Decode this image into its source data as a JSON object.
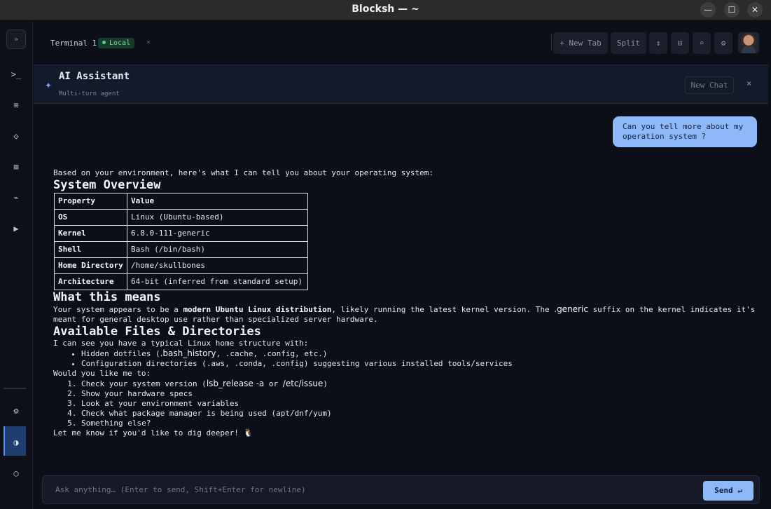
{
  "window": {
    "title": "Blocksh — ~",
    "minimize_glyph": "—",
    "maximize_glyph": "☐",
    "close_glyph": "✕"
  },
  "rail": {
    "toggle_glyph": "»",
    "items": [
      {
        "name": "terminal-icon",
        "glyph": ">_"
      },
      {
        "name": "menu-icon",
        "glyph": "≡"
      },
      {
        "name": "diamond-icon",
        "glyph": "◇"
      },
      {
        "name": "grid-icon",
        "glyph": "⊞"
      },
      {
        "name": "connection-icon",
        "glyph": "⌁"
      },
      {
        "name": "play-icon",
        "glyph": "▶"
      }
    ],
    "bottom": [
      {
        "name": "settings-icon",
        "glyph": "⚙"
      },
      {
        "name": "theme-icon",
        "glyph": "◑"
      },
      {
        "name": "circle-icon",
        "glyph": "○"
      }
    ]
  },
  "tabbar": {
    "tab_label": "Terminal 1",
    "tab_badge": "Local",
    "tab_close": "×",
    "new_tab": "+ New Tab",
    "split": "Split",
    "icons": [
      {
        "name": "sort-icon",
        "glyph": "↕"
      },
      {
        "name": "layout-icon",
        "glyph": "⊟"
      },
      {
        "name": "search-icon",
        "glyph": "⌕"
      },
      {
        "name": "gear-icon",
        "glyph": "⚙"
      }
    ]
  },
  "assistant": {
    "spark_glyph": "✦",
    "title": "AI Assistant",
    "subtitle": "Multi-turn agent",
    "new_chat": "New Chat",
    "close_glyph": "×"
  },
  "chat": {
    "user_message": "Can you tell more about my operation system ?",
    "intro": "Based on your environment, here's what I can tell you about your operating system:",
    "h_overview": "System Overview",
    "table": {
      "headers": [
        "Property",
        "Value"
      ],
      "rows": [
        [
          "OS",
          "Linux (Ubuntu-based)"
        ],
        [
          "Kernel",
          "6.8.0-111-generic"
        ],
        [
          "Shell",
          "Bash (/bin/bash)"
        ],
        [
          "Home Directory",
          "/home/skullbones"
        ],
        [
          "Architecture",
          "64-bit (inferred from standard setup)"
        ]
      ]
    },
    "h_meaning": "What this means",
    "meaning_pre": "Your system appears to be a ",
    "meaning_bold": "modern Ubuntu Linux distribution",
    "meaning_mid": ", likely running the latest kernel version. The ",
    "meaning_code": ".generic",
    "meaning_post": " suffix on the kernel indicates it's meant for general desktop use rather than specialized server hardware.",
    "h_files": "Available Files & Directories",
    "files_intro": "I can see you have a typical Linux home structure with:",
    "bullet1_pre": "Hidden dotfiles (",
    "bullet1_code": ".bash_history",
    "bullet1_post": ", .cache, .config, etc.)",
    "bullet2": "Configuration directories (.aws, .conda, .config) suggesting various installed tools/services",
    "ask": "Would you like me to:",
    "opt1_pre": "Check your system version (",
    "opt1_code1": "lsb_release -a",
    "opt1_mid": " or ",
    "opt1_code2": "/etc/issue",
    "opt1_post": ")",
    "opt2": "Show your hardware specs",
    "opt3": "Look at your environment variables",
    "opt4": "Check what package manager is being used (apt/dnf/yum)",
    "opt5": "Something else?",
    "outro": "Let me know if you'd like to dig deeper! 🐧"
  },
  "input": {
    "placeholder": "Ask anything… (Enter to send, Shift+Enter for newline)",
    "send": "Send ↵"
  }
}
